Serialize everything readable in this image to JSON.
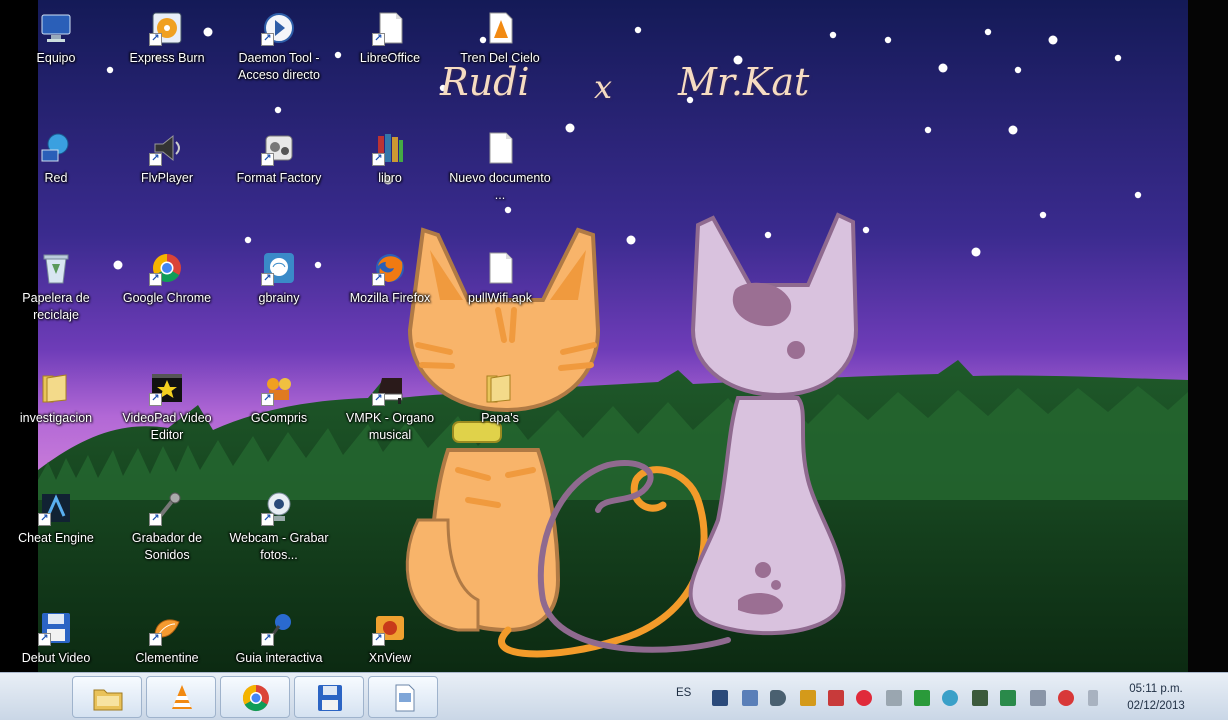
{
  "wallpaper": {
    "title_left": "Rudi",
    "title_mid": "x",
    "title_right": "Mr.Kat"
  },
  "desktop_icons": [
    {
      "label": "Equipo",
      "icon": "computer-icon"
    },
    {
      "label": "Express Burn",
      "icon": "express-burn-icon"
    },
    {
      "label": "Daemon Tool - Acceso directo",
      "icon": "daemon-tools-icon"
    },
    {
      "label": "LibreOffice",
      "icon": "libreoffice-icon"
    },
    {
      "label": "Tren Del Cielo",
      "icon": "vlc-file-icon"
    },
    {
      "label": "Red",
      "icon": "network-icon"
    },
    {
      "label": "FlvPlayer",
      "icon": "flvplayer-icon"
    },
    {
      "label": "Format Factory",
      "icon": "format-factory-icon"
    },
    {
      "label": "libro",
      "icon": "books-icon"
    },
    {
      "label": "Nuevo documento ...",
      "icon": "document-icon"
    },
    {
      "label": "Papelera de reciclaje",
      "icon": "recycle-bin-icon"
    },
    {
      "label": "Google Chrome",
      "icon": "chrome-icon"
    },
    {
      "label": "gbrainy",
      "icon": "gbrainy-icon"
    },
    {
      "label": "Mozilla Firefox",
      "icon": "firefox-icon"
    },
    {
      "label": "pullWifi.apk",
      "icon": "apk-file-icon"
    },
    {
      "label": "investigacion",
      "icon": "folder-icon"
    },
    {
      "label": "VideoPad Video Editor",
      "icon": "videopad-icon"
    },
    {
      "label": "GCompris",
      "icon": "gcompris-icon"
    },
    {
      "label": "VMPK - Organo musical",
      "icon": "piano-icon"
    },
    {
      "label": "Papa's",
      "icon": "folder-icon"
    },
    {
      "label": "Cheat Engine",
      "icon": "cheat-engine-icon"
    },
    {
      "label": "Grabador de Sonidos",
      "icon": "microphone-icon"
    },
    {
      "label": "Webcam - Grabar fotos...",
      "icon": "webcam-icon"
    },
    {
      "label": "Debut Video",
      "icon": "floppy-disk-icon"
    },
    {
      "label": "Clementine",
      "icon": "clementine-icon"
    },
    {
      "label": "Guia interactiva",
      "icon": "pushpin-icon"
    },
    {
      "label": "XnView",
      "icon": "xnview-icon"
    }
  ],
  "taskbar": {
    "pinned": [
      {
        "name": "explorer",
        "icon": "folder-icon"
      },
      {
        "name": "vlc",
        "icon": "vlc-icon"
      },
      {
        "name": "chrome",
        "icon": "chrome-icon"
      },
      {
        "name": "debut",
        "icon": "floppy-disk-icon"
      },
      {
        "name": "document",
        "icon": "document-icon"
      }
    ],
    "language": "ES",
    "clock_time": "05:11 p.m.",
    "clock_date": "02/12/2013"
  },
  "colors": {
    "sky_top": "#151c5c",
    "sky_mid": "#5a2fa2",
    "horizon": "#b05fd0",
    "grass": "#143d1e",
    "orange_cat": "#f8b46a",
    "lilac_cat": "#d9c2de"
  }
}
